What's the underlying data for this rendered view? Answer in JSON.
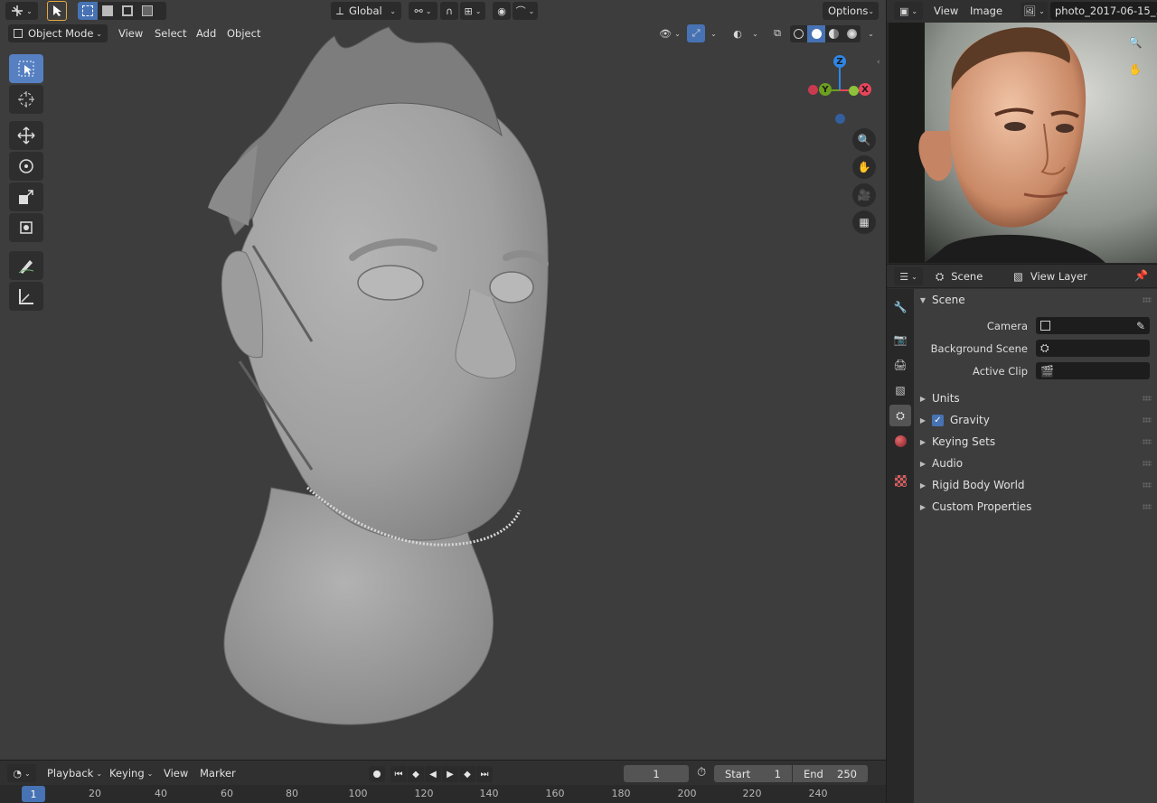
{
  "viewport": {
    "header": {
      "transform_orientation": "Global",
      "options_label": "Options"
    },
    "header2": {
      "mode": "Object Mode",
      "menus": [
        "View",
        "Select",
        "Add",
        "Object"
      ]
    },
    "gizmo": {
      "z": "Z",
      "y": "Y",
      "x": "X"
    }
  },
  "image_editor": {
    "menus": [
      "View",
      "Image"
    ],
    "image_name": "photo_2017-06-15_..."
  },
  "properties": {
    "tabs": {
      "scene": "Scene",
      "view_layer": "View Layer"
    },
    "scene_panel": {
      "title": "Scene",
      "fields": [
        {
          "label": "Camera",
          "value": ""
        },
        {
          "label": "Background Scene",
          "value": ""
        },
        {
          "label": "Active Clip",
          "value": ""
        }
      ]
    },
    "collapsed_panels": [
      "Units",
      "Gravity",
      "Keying Sets",
      "Audio",
      "Rigid Body World",
      "Custom Properties"
    ],
    "gravity_checked": true
  },
  "timeline": {
    "menus": [
      "Playback",
      "Keying",
      "View",
      "Marker"
    ],
    "current_frame": "1",
    "start_label": "Start",
    "start_value": "1",
    "end_label": "End",
    "end_value": "250",
    "ruler_current": "1",
    "ruler_ticks": [
      "20",
      "40",
      "60",
      "80",
      "100",
      "120",
      "140",
      "160",
      "180",
      "200",
      "220",
      "240"
    ]
  },
  "colors": {
    "accent": "#4772b3",
    "axis_x": "#e8445c",
    "axis_y": "#6c9f1f",
    "axis_z": "#2e86e6"
  }
}
